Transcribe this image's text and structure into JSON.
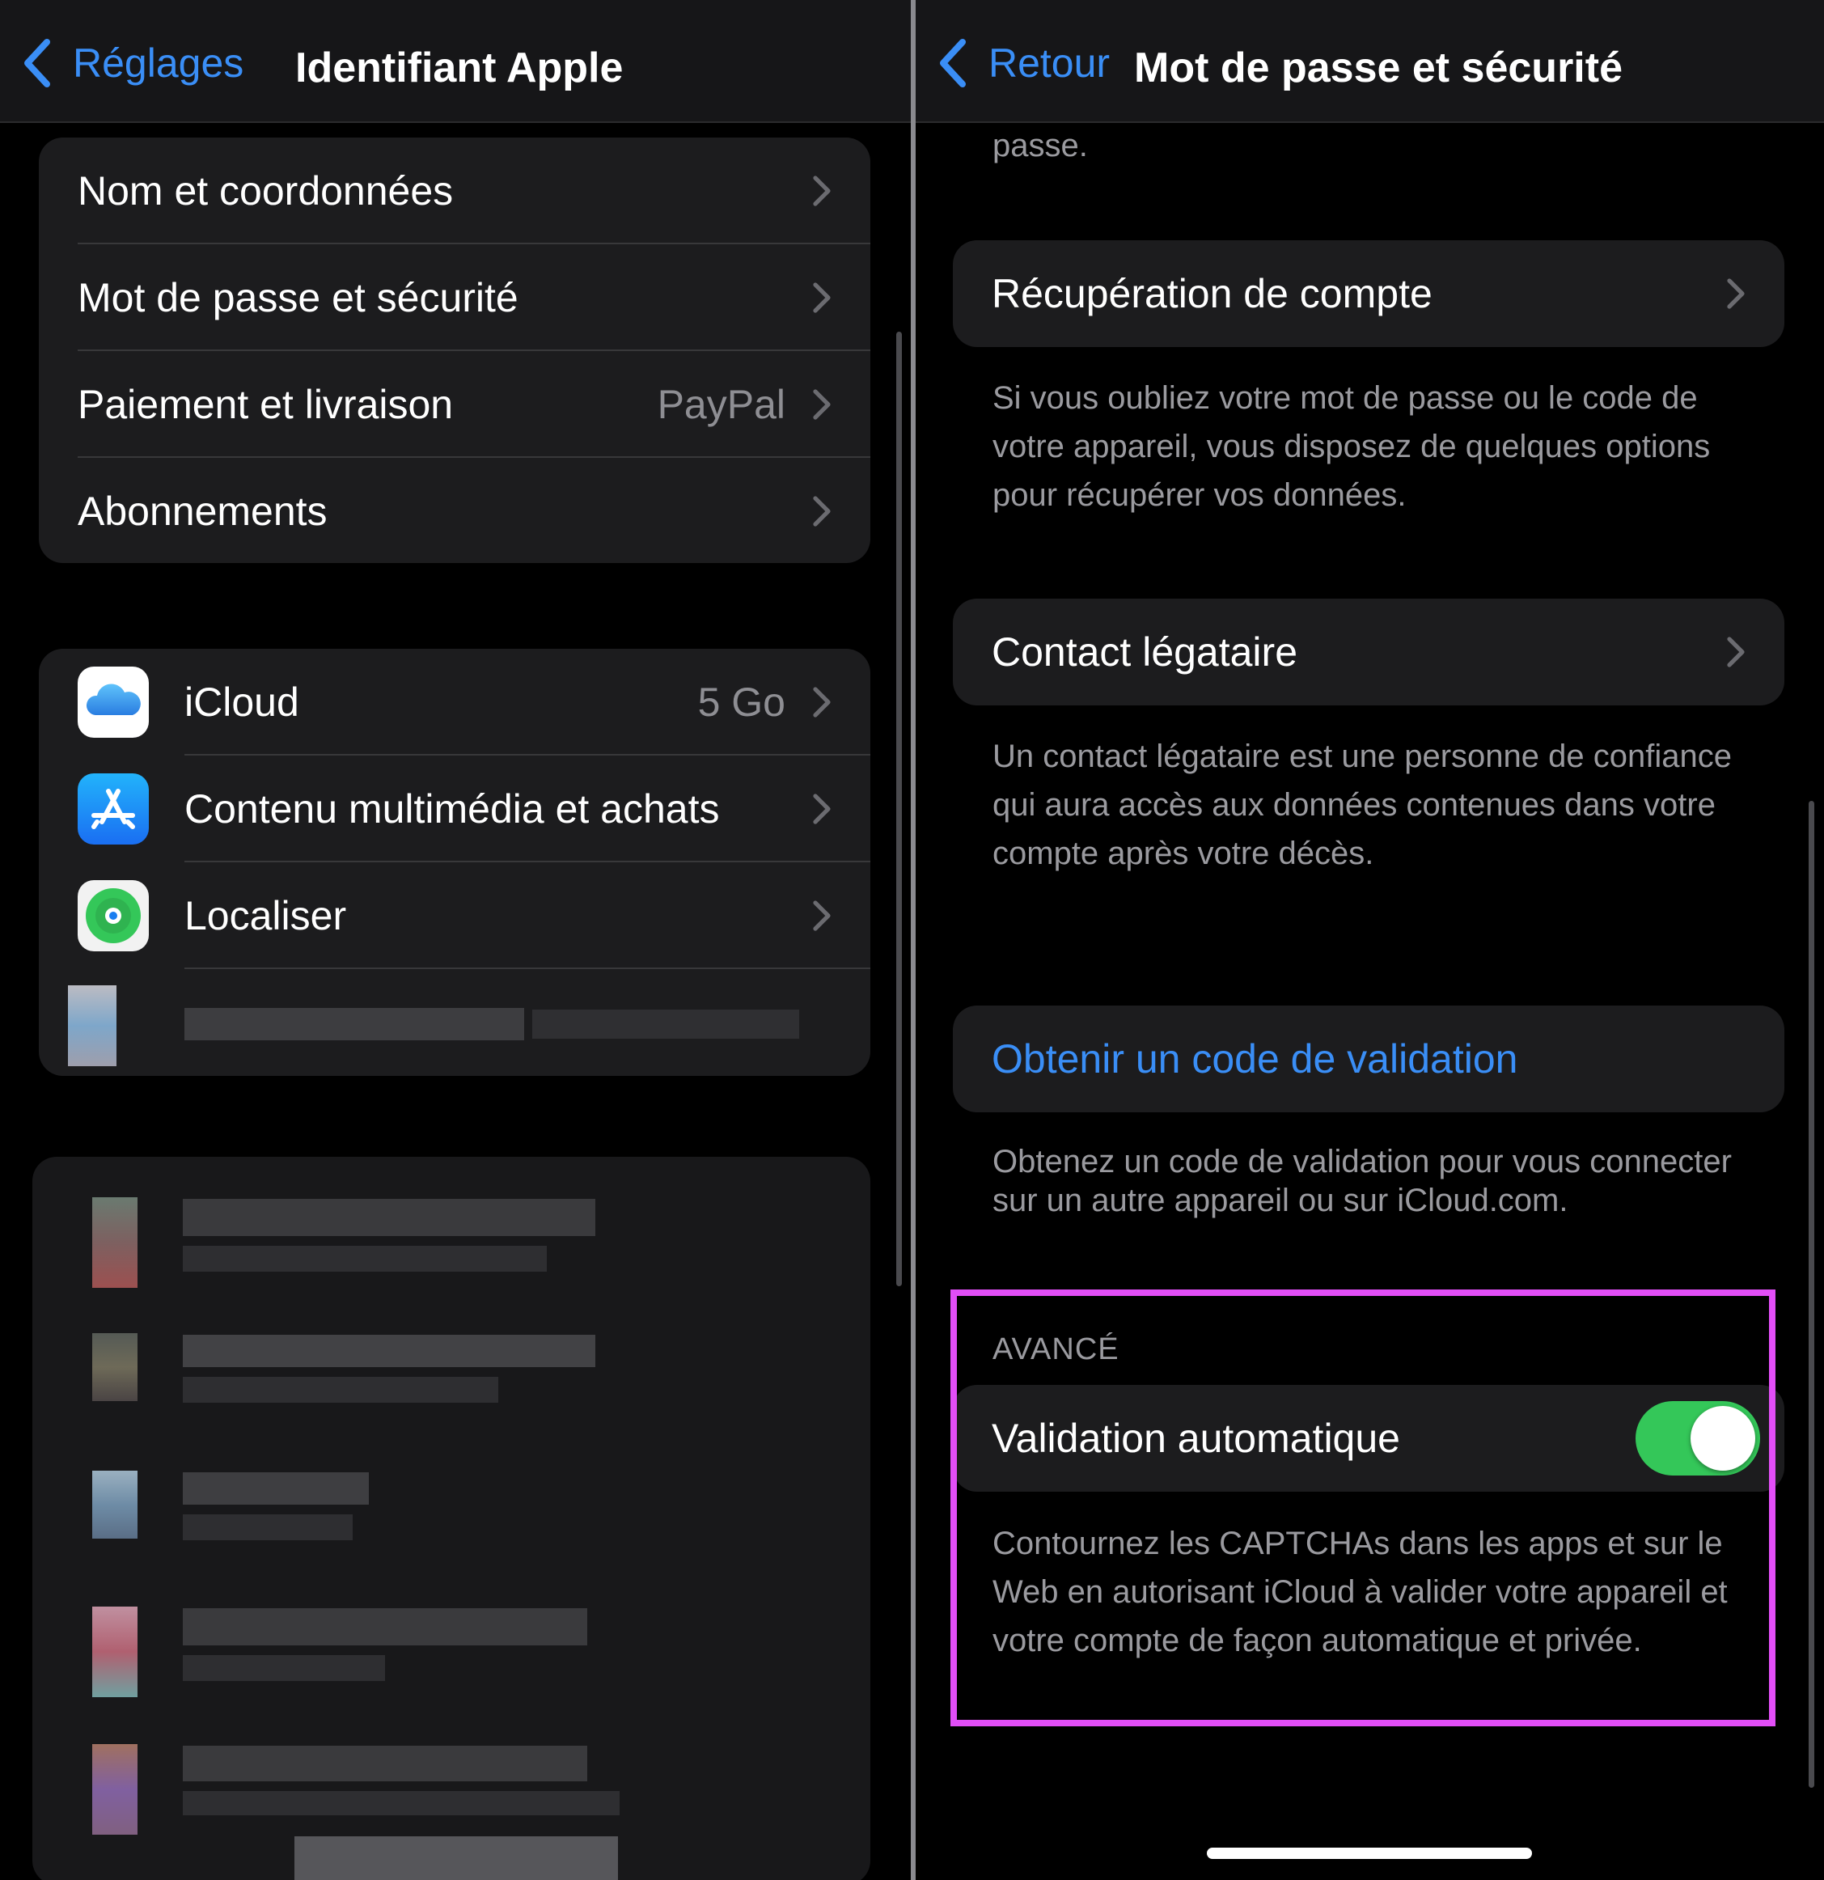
{
  "left": {
    "nav": {
      "back_label": "Réglages",
      "title": "Identifiant Apple"
    },
    "account_group": [
      {
        "label": "Nom et coordonnées",
        "value": ""
      },
      {
        "label": "Mot de passe et sécurité",
        "value": ""
      },
      {
        "label": "Paiement et livraison",
        "value": "PayPal"
      },
      {
        "label": "Abonnements",
        "value": ""
      }
    ],
    "services_group": [
      {
        "label": "iCloud",
        "value": "5 Go",
        "icon": "icloud-icon"
      },
      {
        "label": "Contenu multimédia et achats",
        "value": "",
        "icon": "app-store-icon"
      },
      {
        "label": "Localiser",
        "value": "",
        "icon": "find-my-icon"
      }
    ]
  },
  "right": {
    "nav": {
      "back_label": "Retour",
      "title": "Mot de passe et sécurité"
    },
    "top_fragment": "passe.",
    "account_recovery": {
      "label": "Récupération de compte",
      "note": "Si vous oubliez votre mot de passe ou le code de votre appareil, vous disposez de quelques options pour récupérer vos données."
    },
    "legacy_contact": {
      "label": "Contact légataire",
      "note": "Un contact légataire est une personne de confiance qui aura accès aux données contenues dans votre compte après votre décès."
    },
    "verification_code": {
      "label": "Obtenir un code de validation",
      "note": "Obtenez un code de validation pour vous connecter sur un autre appareil ou sur iCloud.com."
    },
    "advanced": {
      "header": "AVANCÉ",
      "label": "Validation automatique",
      "toggle_on": true,
      "note": "Contournez les CAPTCHAs dans les apps et sur le Web en autorisant iCloud à valider votre appareil et votre compte de façon automatique et privée."
    }
  },
  "colors": {
    "accent": "#3a8ef6",
    "toggle_on": "#34c759",
    "highlight": "#e24ef7",
    "cell_bg": "#1c1c1e"
  }
}
